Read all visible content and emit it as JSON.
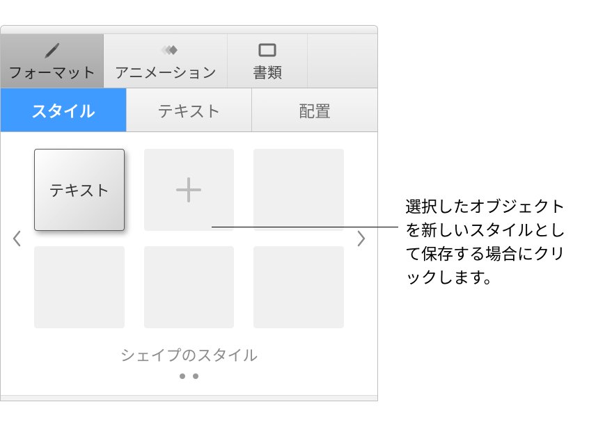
{
  "toolbar": {
    "format_label": "フォーマット",
    "animation_label": "アニメーション",
    "document_label": "書類"
  },
  "tabs": {
    "style": "スタイル",
    "text": "テキスト",
    "arrange": "配置"
  },
  "styles": {
    "tile_text_label": "テキスト",
    "section_label": "シェイプのスタイル"
  },
  "callout": {
    "text": "選択したオブジェクトを新しいスタイルとして保存する場合にクリックします。"
  }
}
